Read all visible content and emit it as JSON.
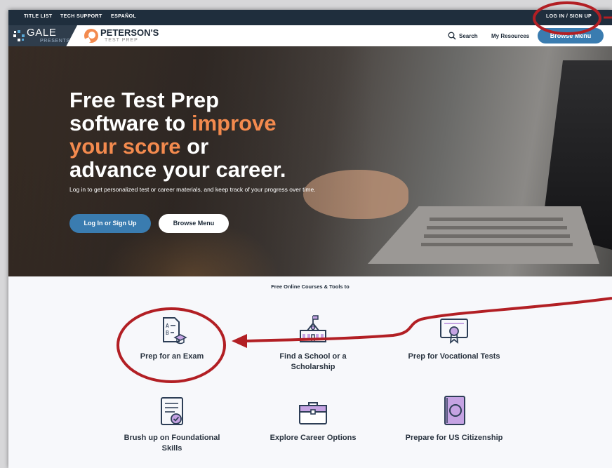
{
  "utility_bar": {
    "links": [
      "TITLE LIST",
      "TECH SUPPORT",
      "ESPAÑOL"
    ],
    "login_signup": "LOG IN / SIGN UP"
  },
  "nav": {
    "gale_brand": "GALE",
    "gale_sub": "PRESENTS",
    "petersons_brand": "PETERSON'S",
    "petersons_sub": "TEST PREP",
    "search_label": "Search",
    "resources_label": "My Resources",
    "browse_menu_label": "Browse Menu"
  },
  "hero": {
    "title_line1": "Free Test Prep",
    "title_line2_a": "software to ",
    "title_line2_b": "improve",
    "title_line3_a": "your score",
    "title_line3_b": " or",
    "title_line4": "advance your career.",
    "description": "Log in to get personalized test or career materials, and keep track of your progress over time.",
    "login_button": "Log In or Sign Up",
    "browse_button": "Browse Menu"
  },
  "tools": {
    "heading": "Free Online Courses & Tools to",
    "items": [
      {
        "label": "Prep for an Exam",
        "icon": "exam-paper-icon"
      },
      {
        "label": "Find a School or a Scholarship",
        "icon": "school-building-icon"
      },
      {
        "label": "Prep for Vocational Tests",
        "icon": "certificate-icon"
      },
      {
        "label": "Brush up on Foundational Skills",
        "icon": "document-check-icon"
      },
      {
        "label": "Explore Career Options",
        "icon": "briefcase-icon"
      },
      {
        "label": "Prepare for US Citizenship",
        "icon": "passport-icon"
      }
    ]
  },
  "colors": {
    "accent_orange": "#f38a4e",
    "button_blue": "#3a7cb0",
    "navy": "#1f2e3d",
    "annotation_red": "#b21f24",
    "icon_purple": "#c5a3e3",
    "icon_navy": "#2d3e56"
  }
}
